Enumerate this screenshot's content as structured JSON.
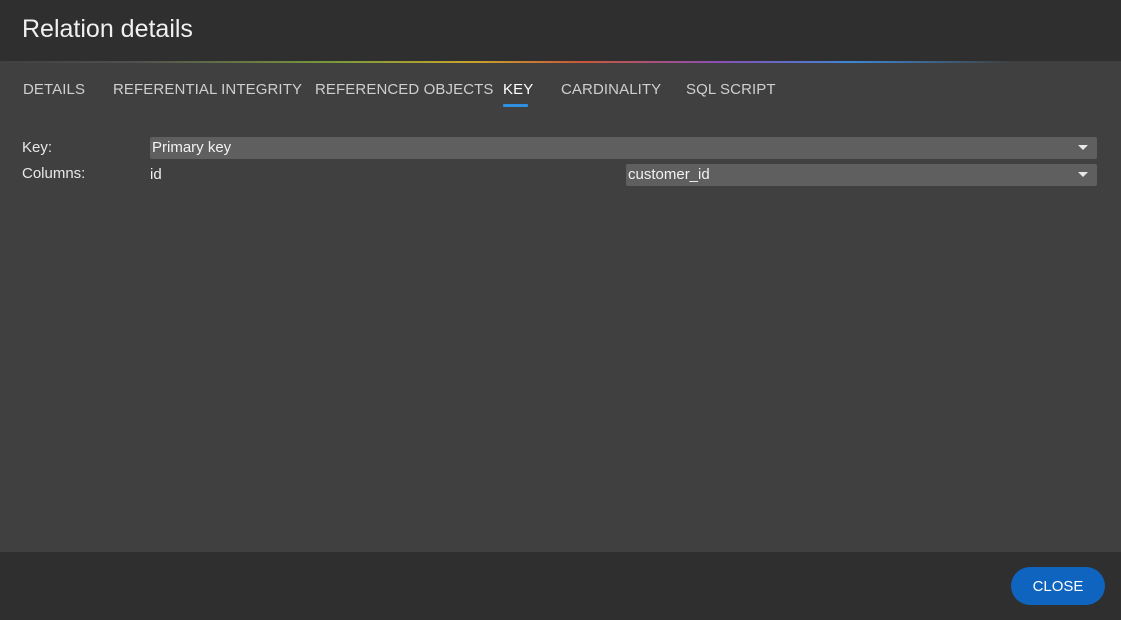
{
  "dialog": {
    "title": "Relation details"
  },
  "tabs": [
    {
      "label": "DETAILS",
      "active": false
    },
    {
      "label": "REFERENTIAL INTEGRITY",
      "active": false
    },
    {
      "label": "REFERENCED OBJECTS",
      "active": false
    },
    {
      "label": "KEY",
      "active": true
    },
    {
      "label": "CARDINALITY",
      "active": false
    },
    {
      "label": "SQL SCRIPT",
      "active": false
    }
  ],
  "key_form": {
    "key_label": "Key:",
    "key_value": "Primary key",
    "columns_label": "Columns:",
    "column_source": "id",
    "column_target": "customer_id"
  },
  "footer": {
    "close_label": "CLOSE"
  },
  "colors": {
    "accent_blue": "#2f8fe0",
    "button_blue": "#0f64c0",
    "header_bg": "#2f2f2f",
    "body_bg": "#404040"
  },
  "icons": {
    "dropdown": "caret-down-icon"
  }
}
